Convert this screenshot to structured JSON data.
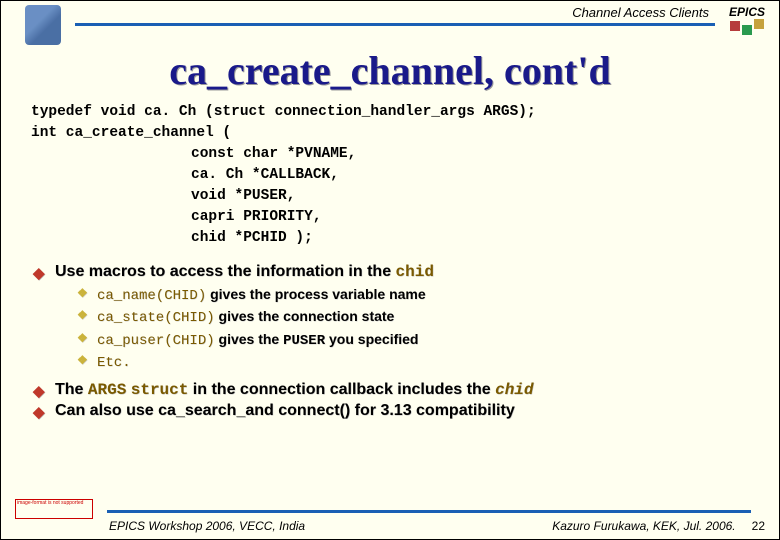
{
  "header": {
    "subject": "Channel Access Clients",
    "logo_text": "EPICS"
  },
  "title": "ca_create_channel, cont'd",
  "code": {
    "l1": "typedef void ca. Ch (struct connection_handler_args ARGS);",
    "l2": "int ca_create_channel (",
    "l3": "const char *PVNAME,",
    "l4": "ca. Ch *CALLBACK,",
    "l5": "void *PUSER,",
    "l6": "capri PRIORITY,",
    "l7": "chid *PCHID );"
  },
  "bullets": {
    "b1_pre": "Use macros to access the information in the ",
    "b1_code": "chid",
    "sub": [
      {
        "code": "ca_name(CHID)",
        "text": " gives the process variable name"
      },
      {
        "code": "ca_state(CHID)",
        "text": " gives the connection state"
      },
      {
        "code_pre": "ca_puser(CHID)",
        "text_pre": " gives the ",
        "code_mid": "PUSER",
        "text_post": " you specified"
      },
      {
        "code": "Etc.",
        "text": ""
      }
    ],
    "b2_pre": "The ",
    "b2_c1": "ARGS",
    "b2_mid": " ",
    "b2_c2": "struct",
    "b2_post": " in the connection callback includes the ",
    "b2_c3": "chid",
    "b3": "Can also use ca_search_and connect() for 3.13 compatibility"
  },
  "footer": {
    "img_missing": "image-format is not supported",
    "left": "EPICS Workshop 2006, VECC, India",
    "right": "Kazuro Furukawa, KEK, Jul. 2006.",
    "slide": "22"
  }
}
